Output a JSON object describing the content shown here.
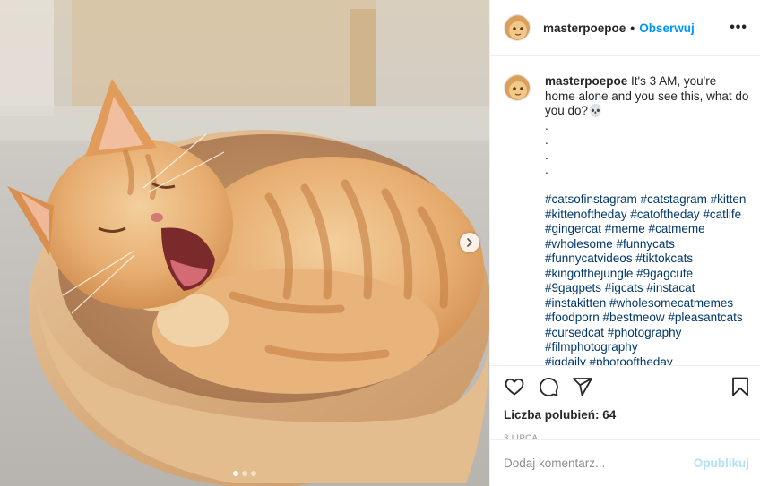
{
  "header": {
    "username": "masterpoepoe",
    "separator": "•",
    "follow_label": "Obserwuj",
    "more_label": "•••"
  },
  "caption": {
    "username": "masterpoepoe",
    "text": "It's 3 AM, you're home alone and you see this, what do you do?",
    "emoji": "💀",
    "dot_lines": [
      ".",
      ".",
      ".",
      "."
    ],
    "hashtags": [
      "#catsofinstagram #catstagram #kitten",
      "#kittenoftheday #catoftheday #catlife",
      "#gingercat #meme #catmeme",
      "#wholesome #funnycats",
      "#funnycatvideos #tiktokcats",
      "#kingofthejungle #9gagcute",
      "#9gagpets #igcats #instacat",
      "#instakitten #wholesomecatmemes",
      "#foodporn #bestmeow #pleasantcats",
      "#cursedcat #photography",
      "#filmphotography",
      "#igdaily #photooftheday"
    ]
  },
  "likes": {
    "label": "Liczba polubień: 64"
  },
  "date": {
    "label": "3 LIPCA"
  },
  "add_comment": {
    "placeholder": "Dodaj komentarz...",
    "post_label": "Opublikuj"
  },
  "carousel": {
    "slide_count": 3,
    "active_index": 0
  },
  "colors": {
    "link": "#0095f6",
    "hashtag": "#00376b",
    "post_disabled": "#b2dffc"
  },
  "icons": [
    "heart-icon",
    "comment-icon",
    "share-icon",
    "bookmark-icon",
    "chevron-right-icon"
  ]
}
